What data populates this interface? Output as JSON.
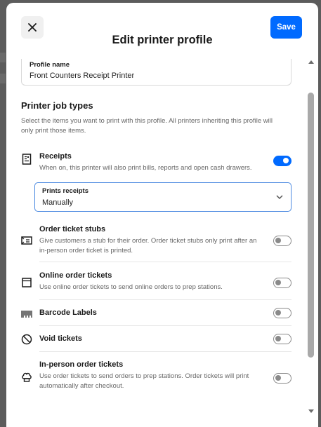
{
  "header": {
    "title": "Edit printer profile",
    "save_label": "Save"
  },
  "profile_name": {
    "label": "Profile name",
    "value": "Front Counters Receipt Printer"
  },
  "job_types": {
    "title": "Printer job types",
    "description": "Select the items you want to print with this profile. All printers inheriting this profile will only print those items.",
    "items": [
      {
        "name": "Receipts",
        "description": "When on, this printer will also print bills, reports and open cash drawers.",
        "icon": "receipt-icon",
        "enabled": true
      },
      {
        "name": "Order ticket stubs",
        "description": "Give customers a stub for their order. Order ticket stubs only print after an in-person order ticket is printed.",
        "icon": "ticket-stub-icon",
        "enabled": false
      },
      {
        "name": "Online order tickets",
        "description": "Use online order tickets to send online orders to prep stations.",
        "icon": "browser-window-icon",
        "enabled": false
      },
      {
        "name": "Barcode Labels",
        "description": "",
        "icon": "barcode-icon",
        "enabled": false
      },
      {
        "name": "Void tickets",
        "description": "",
        "icon": "void-circle-icon",
        "enabled": false
      },
      {
        "name": "In-person order tickets",
        "description": "Use order tickets to send orders to prep stations. Order tickets will print automatically after checkout.",
        "icon": "chef-hat-icon",
        "enabled": false
      }
    ]
  },
  "prints_receipts": {
    "label": "Prints receipts",
    "value": "Manually"
  },
  "colors": {
    "accent": "#006aff"
  }
}
